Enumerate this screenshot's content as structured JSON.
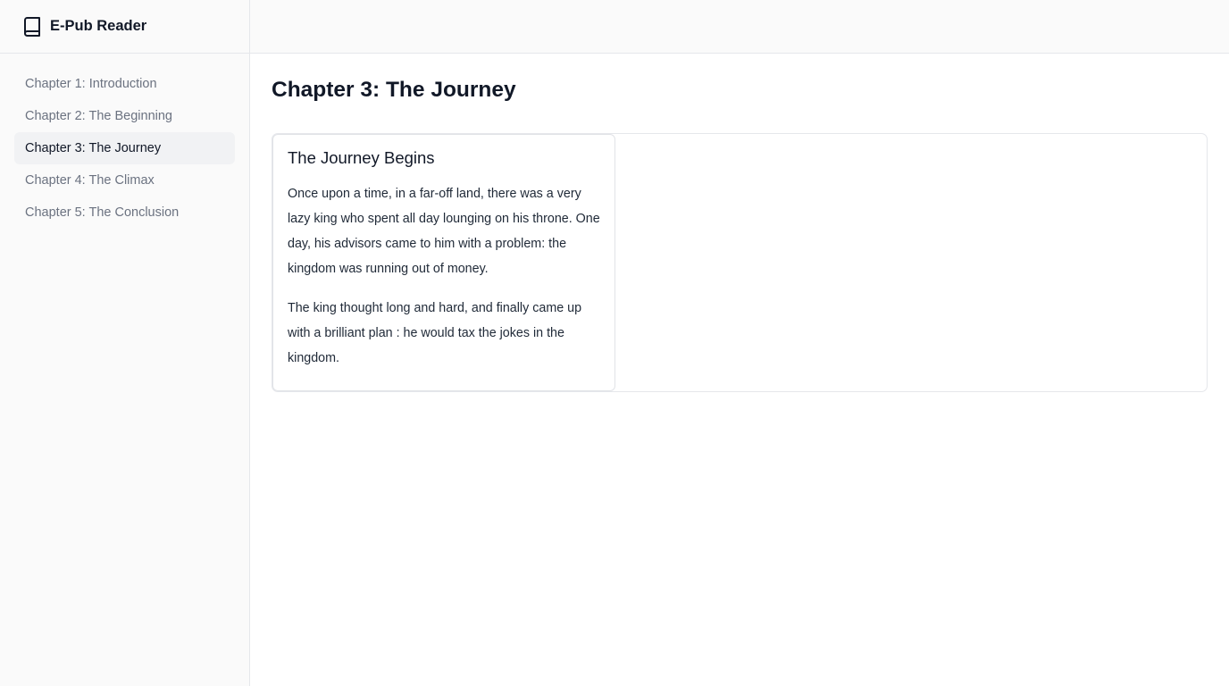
{
  "app": {
    "title": "E-Pub Reader",
    "icon": "book-icon"
  },
  "sidebar": {
    "items": [
      {
        "label": "Chapter 1: Introduction",
        "active": false
      },
      {
        "label": "Chapter 2: The Beginning",
        "active": false
      },
      {
        "label": "Chapter 3: The Journey",
        "active": true
      },
      {
        "label": "Chapter 4: The Climax",
        "active": false
      },
      {
        "label": "Chapter 5: The Conclusion",
        "active": false
      }
    ]
  },
  "main": {
    "chapter_title": "Chapter 3: The Journey",
    "page": {
      "section_title": "The Journey Begins",
      "paragraphs": [
        "Once upon a time, in a far-off land, there was a very lazy king who spent all day lounging on his throne. One day, his advisors came to him with a problem: the kingdom was running out of money.",
        "The king thought long and hard, and finally came up with a brilliant plan : he would tax the jokes in the kingdom."
      ]
    }
  },
  "colors": {
    "active_bg": "#f1f2f4",
    "muted_text": "#6b7280",
    "border": "#e5e7eb"
  }
}
